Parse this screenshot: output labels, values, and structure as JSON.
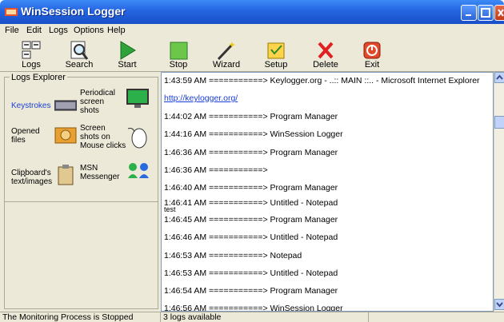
{
  "window": {
    "title": "WinSession Logger"
  },
  "menu": [
    "File",
    "Edit",
    "Logs",
    "Options",
    "Help"
  ],
  "toolbar": {
    "logs": "Logs",
    "search": "Search",
    "start": "Start",
    "stop": "Stop",
    "wizard": "Wizard",
    "setup": "Setup",
    "delete": "Delete",
    "exit": "Exit"
  },
  "explorer": {
    "title": "Logs Explorer",
    "keystrokes": "Keystrokes",
    "periodical": "Periodical screen shots",
    "opened": "Opened files",
    "mouse": "Screen shots on Mouse clicks",
    "clipboard": "Clipboard's text/images",
    "msn": "MSN Messenger"
  },
  "log": [
    "1:43:59 AM ===========> Keylogger.org - ..:: MAIN ::.. - Microsoft Internet Explorer",
    "http://keylogger.org/",
    "1:44:02 AM ===========> Program Manager",
    "1:44:16 AM ===========> WinSession Logger",
    "1:46:36 AM ===========> Program Manager",
    "1:46:36 AM ===========>",
    "1:46:40 AM ===========> Program Manager",
    "1:46:41 AM ===========> Untitled - Notepad",
    "test",
    "1:46:45 AM ===========> Program Manager",
    "1:46:46 AM ===========> Untitled - Notepad",
    "1:46:53 AM ===========> Notepad",
    "1:46:53 AM ===========> Untitled - Notepad",
    "1:46:54 AM ===========> Program Manager",
    "1:46:56 AM ===========> WinSession Logger"
  ],
  "status": {
    "left": "The Monitoring Process is Stopped",
    "right": "3 logs available"
  },
  "colors": {
    "titlebar": "#2464e0",
    "link": "#1a3ed8",
    "panel": "#ece9d8"
  }
}
